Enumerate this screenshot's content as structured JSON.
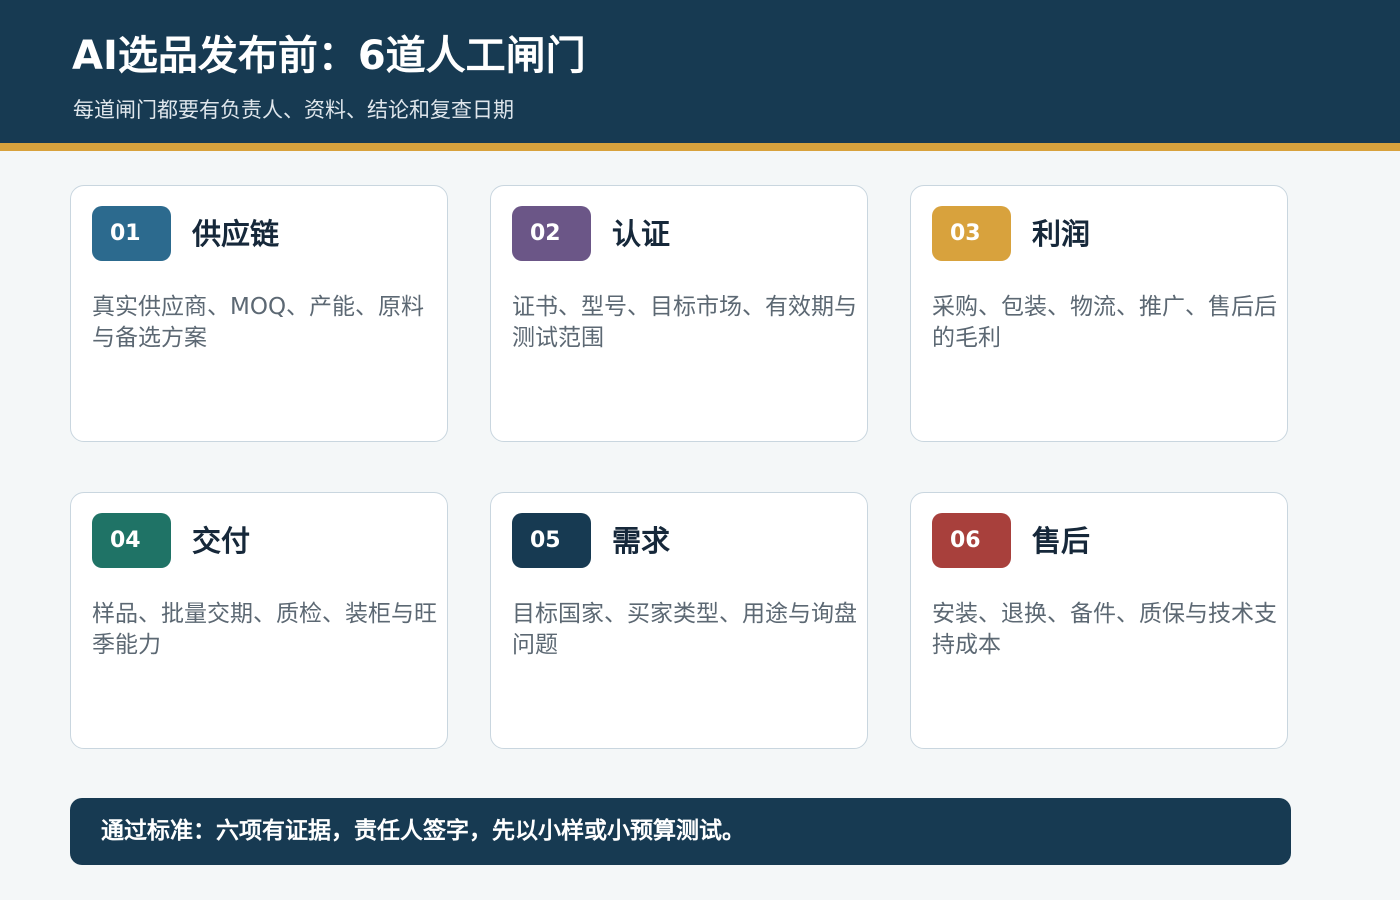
{
  "header": {
    "title": "AI选品发布前：6道人工闸门",
    "subtitle": "每道闸门都要有负责人、资料、结论和复查日期"
  },
  "colors": {
    "header_bg": "#173a52",
    "accent_stripe": "#d8a23d",
    "badge_01": "#2c6a8e",
    "badge_02": "#6b5687",
    "badge_03": "#d8a23d",
    "badge_04": "#1f7366",
    "badge_05": "#173a52",
    "badge_06": "#a8403c"
  },
  "gates": [
    {
      "number": "01",
      "title": "供应链",
      "description": "真实供应商、MOQ、产能、原料与备选方案"
    },
    {
      "number": "02",
      "title": "认证",
      "description": "证书、型号、目标市场、有效期与测试范围"
    },
    {
      "number": "03",
      "title": "利润",
      "description": "采购、包装、物流、推广、售后后的毛利"
    },
    {
      "number": "04",
      "title": "交付",
      "description": "样品、批量交期、质检、装柜与旺季能力"
    },
    {
      "number": "05",
      "title": "需求",
      "description": "目标国家、买家类型、用途与询盘问题"
    },
    {
      "number": "06",
      "title": "售后",
      "description": "安装、退换、备件、质保与技术支持成本"
    }
  ],
  "footer": {
    "text": "通过标准：六项有证据，责任人签字，先以小样或小预算测试。"
  }
}
